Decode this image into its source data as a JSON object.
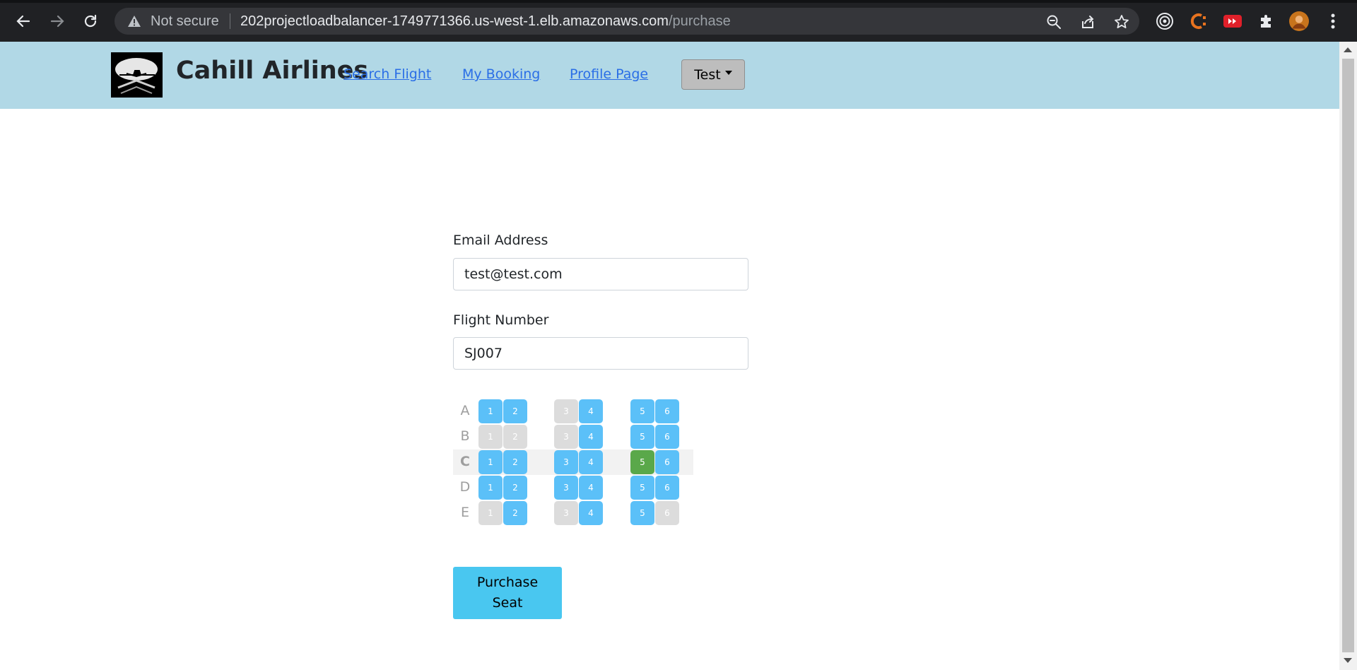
{
  "browser": {
    "security_label": "Not secure",
    "url_host": "202projectloadbalancer-1749771366.us-west-1.elb.amazonaws.com",
    "url_path": "/purchase"
  },
  "navbar": {
    "brand": "Cahill Airlines",
    "links": [
      "Search Flight",
      "My Booking",
      "Profile Page"
    ],
    "user_dropdown": "Test",
    "background": "#b1d8e6"
  },
  "form": {
    "email_label": "Email Address",
    "email_value": "test@test.com",
    "flight_label": "Flight Number",
    "flight_value": "SJ007"
  },
  "seat_map": {
    "rows": [
      {
        "letter": "A",
        "seats": [
          {
            "n": "1",
            "status": "available"
          },
          {
            "n": "2",
            "status": "available"
          },
          {
            "n": "3",
            "status": "taken"
          },
          {
            "n": "4",
            "status": "available"
          },
          {
            "n": "5",
            "status": "available"
          },
          {
            "n": "6",
            "status": "available"
          }
        ]
      },
      {
        "letter": "B",
        "seats": [
          {
            "n": "1",
            "status": "taken"
          },
          {
            "n": "2",
            "status": "taken"
          },
          {
            "n": "3",
            "status": "taken"
          },
          {
            "n": "4",
            "status": "available"
          },
          {
            "n": "5",
            "status": "available"
          },
          {
            "n": "6",
            "status": "available"
          }
        ]
      },
      {
        "letter": "C",
        "selected_row": true,
        "seats": [
          {
            "n": "1",
            "status": "available"
          },
          {
            "n": "2",
            "status": "available"
          },
          {
            "n": "3",
            "status": "available"
          },
          {
            "n": "4",
            "status": "available"
          },
          {
            "n": "5",
            "status": "selected"
          },
          {
            "n": "6",
            "status": "available"
          }
        ]
      },
      {
        "letter": "D",
        "seats": [
          {
            "n": "1",
            "status": "available"
          },
          {
            "n": "2",
            "status": "available"
          },
          {
            "n": "3",
            "status": "available"
          },
          {
            "n": "4",
            "status": "available"
          },
          {
            "n": "5",
            "status": "available"
          },
          {
            "n": "6",
            "status": "available"
          }
        ]
      },
      {
        "letter": "E",
        "seats": [
          {
            "n": "1",
            "status": "taken"
          },
          {
            "n": "2",
            "status": "available"
          },
          {
            "n": "3",
            "status": "taken"
          },
          {
            "n": "4",
            "status": "available"
          },
          {
            "n": "5",
            "status": "available"
          },
          {
            "n": "6",
            "status": "taken"
          }
        ]
      }
    ],
    "colors": {
      "available": "#5bc0f8",
      "taken": "#dcdcdc",
      "selected": "#5aa84a"
    }
  },
  "purchase_button": {
    "line1": "Purchase",
    "line2": "Seat"
  }
}
